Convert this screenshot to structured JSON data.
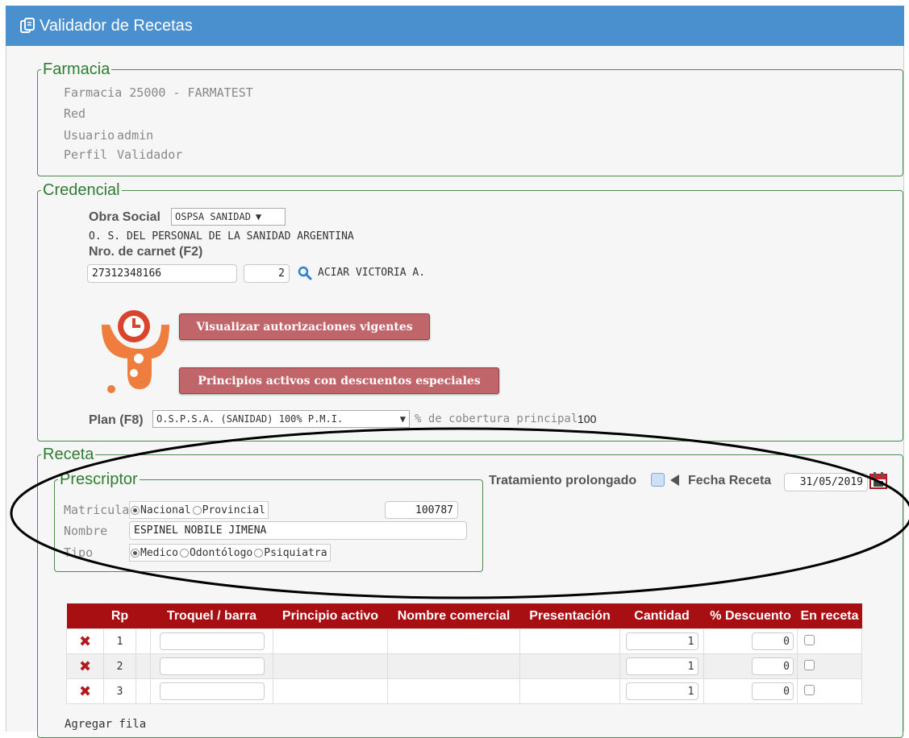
{
  "window": {
    "title": "Validador de Recetas"
  },
  "farmacia": {
    "legend": "Farmacia",
    "lines": [
      {
        "label": "Farmacia",
        "value": "25000 - FARMATEST"
      },
      {
        "label": "Red",
        "value": ""
      },
      {
        "label": "Usuario",
        "value": "admin"
      },
      {
        "label": "Perfil",
        "value": "Validador"
      }
    ]
  },
  "credencial": {
    "legend": "Credencial",
    "obra_social_label": "Obra Social",
    "obra_social_value": "OSPSA SANIDAD",
    "obra_social_full": "O. S. DEL PERSONAL DE LA SANIDAD ARGENTINA",
    "carnet_label": "Nro. de carnet (F2)",
    "carnet_value": "27312348166",
    "carnet_suffix": "2",
    "affiliate_name": "ACIAR VICTORIA A.",
    "btn_autorizaciones": "Visualizar autorizaciones vigentes",
    "btn_principios": "Principios activos con descuentos especiales",
    "plan_label": "Plan (F8)",
    "plan_value": "O.S.P.S.A. (SANIDAD) 100% P.M.I.",
    "cobertura_label": "% de cobertura principal",
    "cobertura_value": "100"
  },
  "receta": {
    "legend": "Receta",
    "tratamiento_label": "Tratamiento prolongado",
    "fecha_label": "Fecha Receta",
    "fecha_value": "31/05/2019",
    "prescriptor": {
      "legend": "Prescriptor",
      "matricula_label": "Matricula",
      "matricula_options": [
        "Nacional",
        "Provincial"
      ],
      "matricula_selected": "Nacional",
      "matricula_value": "100787",
      "nombre_label": "Nombre",
      "nombre_value": "ESPINEL NOBILE JIMENA",
      "tipo_label": "Tipo",
      "tipo_options": [
        "Medico",
        "Odontólogo",
        "Psiquiatra"
      ],
      "tipo_selected": "Medico"
    }
  },
  "table": {
    "columns": [
      "",
      "Rp",
      "",
      "Troquel / barra",
      "Principio activo",
      "Nombre comercial",
      "Presentación",
      "Cantidad",
      "% Descuento",
      "En receta"
    ],
    "rows": [
      {
        "rp": "1",
        "cantidad": "1",
        "descuento": "0"
      },
      {
        "rp": "2",
        "cantidad": "1",
        "descuento": "0"
      },
      {
        "rp": "3",
        "cantidad": "1",
        "descuento": "0"
      }
    ],
    "add_row": "Agregar fila"
  },
  "colors": {
    "titlebar": "#4a90cf",
    "legend": "#2e7d32",
    "table_header": "#a80f12",
    "button": "#c0666a"
  },
  "icons": [
    "clipboard-icon",
    "search-icon",
    "logo-icon",
    "calendar-icon",
    "delete-row-icon",
    "arrow-left-icon"
  ]
}
